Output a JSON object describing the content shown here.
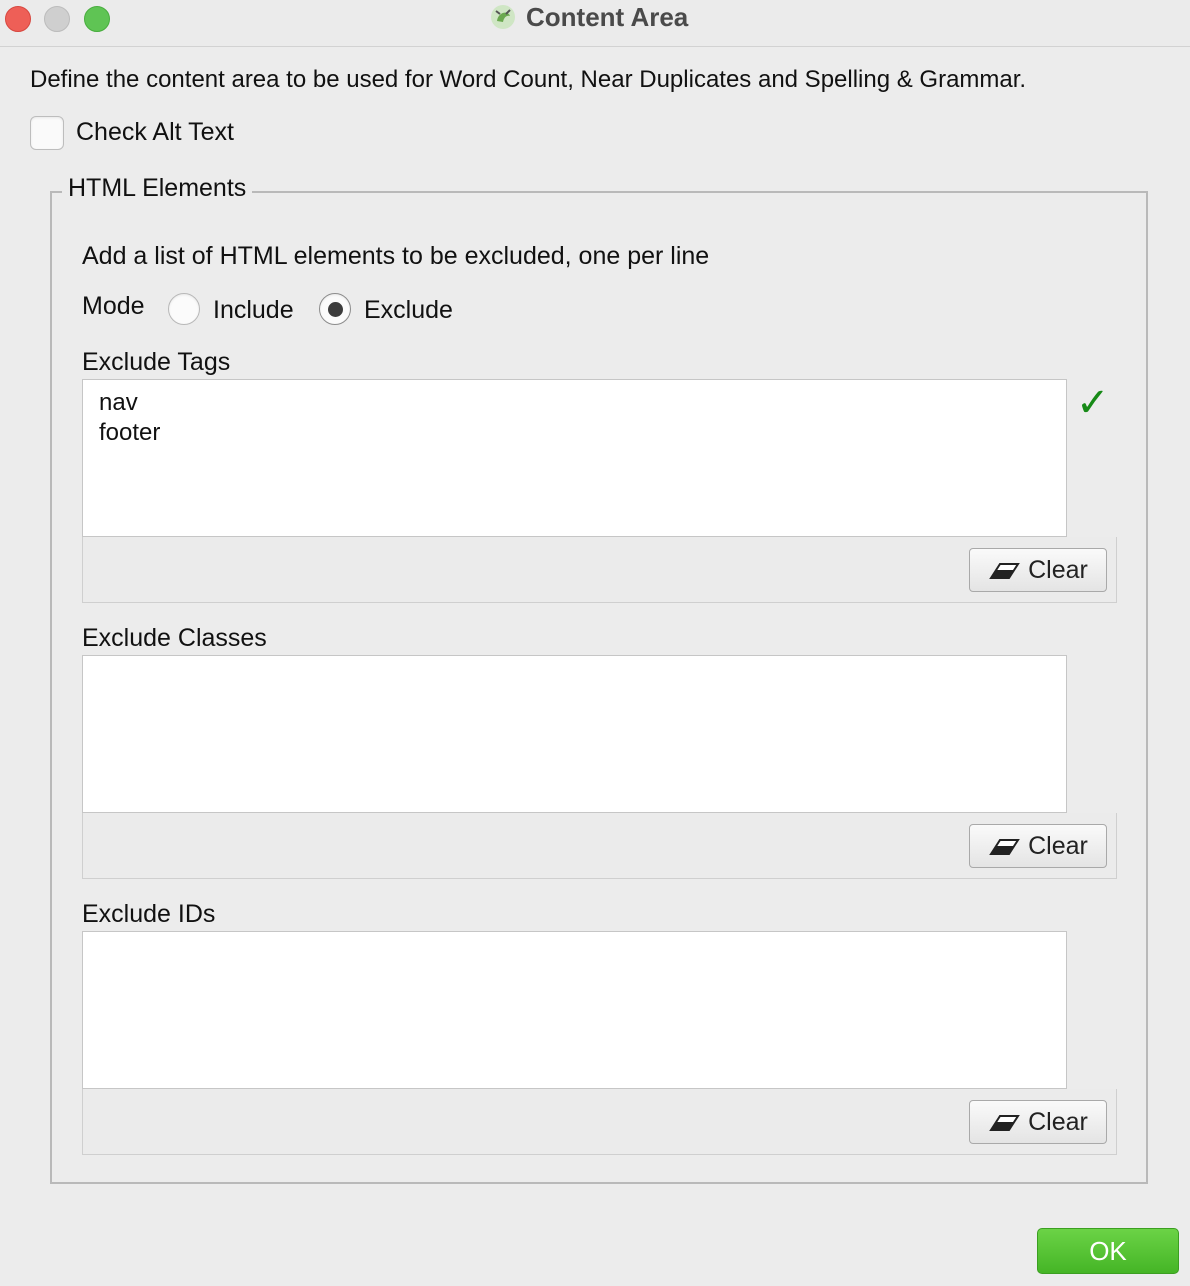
{
  "window": {
    "title": "Content Area",
    "icon": "screaming-frog-icon"
  },
  "description": "Define the content area to be used for Word Count, Near Duplicates and Spelling & Grammar.",
  "check_alt_text": {
    "label": "Check Alt Text",
    "checked": false
  },
  "html_elements": {
    "group_title": "HTML Elements",
    "instruction": "Add a list of HTML elements to be excluded, one per line",
    "mode": {
      "label": "Mode",
      "options": [
        "Include",
        "Exclude"
      ],
      "selected": "Exclude"
    },
    "exclude_tags": {
      "label": "Exclude Tags",
      "lines": [
        "nav",
        "footer"
      ],
      "valid_icon": "checkmark-icon"
    },
    "exclude_classes": {
      "label": "Exclude Classes",
      "lines": []
    },
    "exclude_ids": {
      "label": "Exclude IDs",
      "lines": []
    },
    "clear_label": "Clear"
  },
  "ok_label": "OK",
  "colors": {
    "ok_button": "#52c22f",
    "checkmark": "#178a17"
  }
}
